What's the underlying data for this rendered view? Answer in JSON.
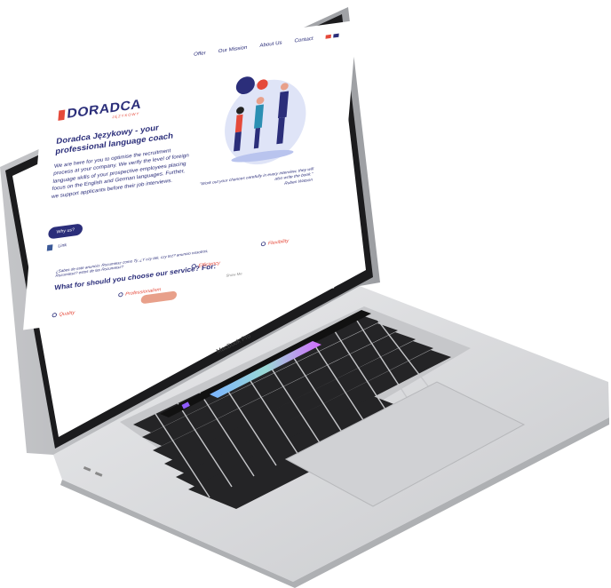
{
  "nav": {
    "items": [
      "Offer",
      "Our Mission",
      "About Us",
      "Contact"
    ],
    "flag_colors": [
      "#e5493a",
      "#2b2e7a"
    ]
  },
  "brand": {
    "name": "DORADCA",
    "sub": "JĘZYKOWY"
  },
  "hero": {
    "headline": "Doradca Językowy - your professional language coach",
    "body": "We are here for you to optimise the recruitment process at your company. We verify the level of foreign language skills of your prospective employees placing focus on the English and German languages. Further, we support applicants before their job interviews.",
    "button": "Why us?",
    "social": [
      "f",
      "Link"
    ]
  },
  "quote": {
    "text": "\"Work out your chances carefully in every interview, they will also write the book.\"",
    "author": "Ruben Watson"
  },
  "services": {
    "intro": "¿Sabes de este anuncio: Rozumiesz como Ty, ¿Y czy tak, czy też? anuncio nosotros, Rozumiesz? estos de las Rozumiesz?",
    "title": "What for should you choose our service? For:",
    "features": [
      "Quality",
      "Professionalism",
      "Efficiency",
      "Flexibility"
    ],
    "show_more": "Show Me"
  },
  "device": {
    "label": "MacBook Pro"
  },
  "colors": {
    "navy": "#2b2e7a",
    "accent": "#e5493a",
    "body_silver": "#d9dadd",
    "bezel": "#1b1b1d",
    "key": "#2a2a2c"
  }
}
